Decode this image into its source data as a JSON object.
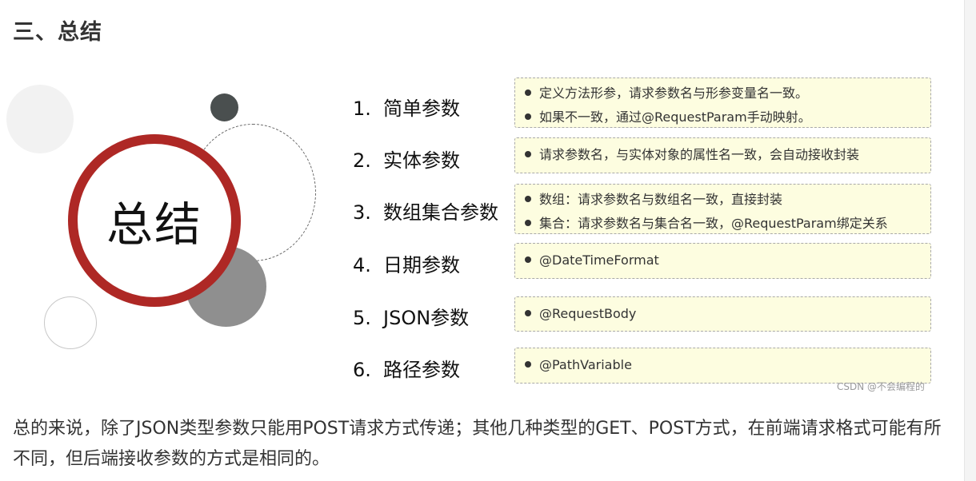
{
  "section_heading": "三、总结",
  "slide": {
    "center_title": "总结",
    "watermark": "CSDN @不会编程的",
    "items": [
      {
        "number": "1.",
        "label": "简单参数",
        "notes": [
          "定义方法形参，请求参数名与形参变量名一致。",
          "如果不一致，通过@RequestParam手动映射。"
        ]
      },
      {
        "number": "2.",
        "label": "实体参数",
        "notes": [
          "请求参数名，与实体对象的属性名一致，会自动接收封装"
        ]
      },
      {
        "number": "3.",
        "label": "数组集合参数",
        "notes": [
          "数组：请求参数名与数组名一致，直接封装",
          "集合：请求参数名与集合名一致，@RequestParam绑定关系"
        ]
      },
      {
        "number": "4.",
        "label": "日期参数",
        "notes": [
          "@DateTimeFormat"
        ]
      },
      {
        "number": "5.",
        "label": "JSON参数",
        "notes": [
          "@RequestBody"
        ]
      },
      {
        "number": "6.",
        "label": "路径参数",
        "notes": [
          "@PathVariable"
        ]
      }
    ]
  },
  "summary_text": "总的来说，除了JSON类型参数只能用POST请求方式传递；其他几种类型的GET、POST方式，在前端请求格式可能有所不同，但后端接收参数的方式是相同的。",
  "colors": {
    "ring": "#ae2825",
    "note_background": "#fdfde0",
    "dark_circle": "#4a4f4f",
    "grey_circle": "#8f8f8f"
  }
}
